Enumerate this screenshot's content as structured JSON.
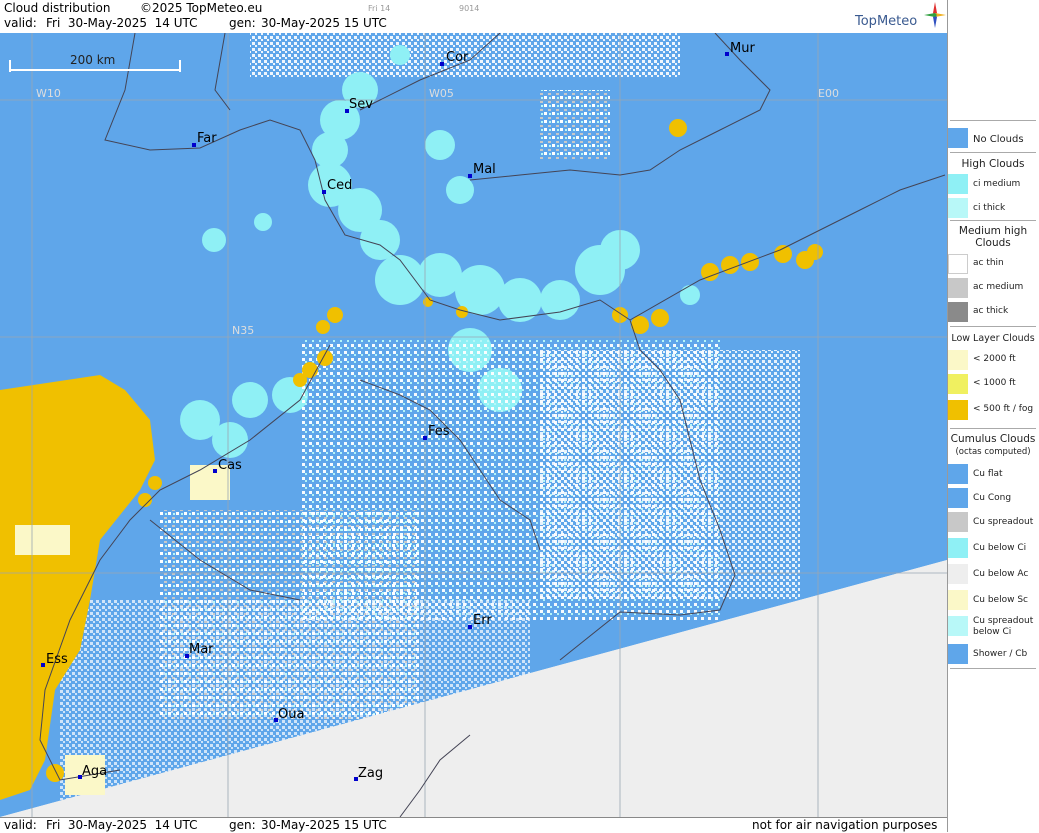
{
  "header": {
    "title": "Cloud distribution",
    "copyright": "©2025 TopMeteo.eu",
    "day_code": "Fri 14",
    "code": "9014",
    "valid_label": "valid:",
    "valid_value": "Fri  30-May-2025  14 UTC",
    "gen_label": "gen:",
    "gen_value": "30-May-2025 15 UTC",
    "brand": "TopMeteo"
  },
  "map": {
    "scale_label": "200 km",
    "grid_labels": {
      "w10": "W10",
      "w05": "W05",
      "e00": "E00",
      "n35": "N35"
    },
    "cities": [
      {
        "name": "Cor"
      },
      {
        "name": "Mur"
      },
      {
        "name": "Sev"
      },
      {
        "name": "Far"
      },
      {
        "name": "Mal"
      },
      {
        "name": "Ced"
      },
      {
        "name": "Fes"
      },
      {
        "name": "Cas"
      },
      {
        "name": "Err"
      },
      {
        "name": "Ess"
      },
      {
        "name": "Mar"
      },
      {
        "name": "Oua"
      },
      {
        "name": "Aga"
      },
      {
        "name": "Zag"
      }
    ]
  },
  "footer": {
    "valid_label": "valid:",
    "valid_value": "Fri  30-May-2025  14 UTC",
    "gen_label": "gen:",
    "gen_value": "30-May-2025 15 UTC",
    "disclaimer": "not for air navigation purposes"
  },
  "legend": {
    "no_clouds": "No Clouds",
    "high_clouds": "High Clouds",
    "ci_medium": "ci medium",
    "ci_thick": "ci thick",
    "medium_high": "Medium high Clouds",
    "ac_thin": "ac thin",
    "ac_medium": "ac medium",
    "ac_thick": "ac thick",
    "low_layer": "Low Layer Clouds",
    "lt2000": "< 2000 ft",
    "lt1000": "< 1000 ft",
    "lt500": "< 500 ft / fog",
    "cumulus": "Cumulus Clouds",
    "octas": "(octas computed)",
    "cu_flat": "Cu flat",
    "cu_cong": "Cu Cong",
    "cu_spreadout": "Cu spreadout",
    "cu_below_ci": "Cu below Ci",
    "cu_below_ac": "Cu below Ac",
    "cu_below_sc": "Cu below Sc",
    "cu_spreadout_below_ci": "Cu spreadout below Ci",
    "shower_cb": "Shower / Cb"
  },
  "colors": {
    "no_clouds": "#5fa6ea",
    "ci_medium": "#8ff0f5",
    "ci_thick": "#b8f8f8",
    "ac_thin": "#ffffff",
    "ac_medium": "#c8c8c8",
    "ac_thick": "#8a8a8a",
    "lt2000": "#fbf8c8",
    "lt1000": "#f0f060",
    "lt500": "#f0c000",
    "no_data": "#eeeeee"
  }
}
